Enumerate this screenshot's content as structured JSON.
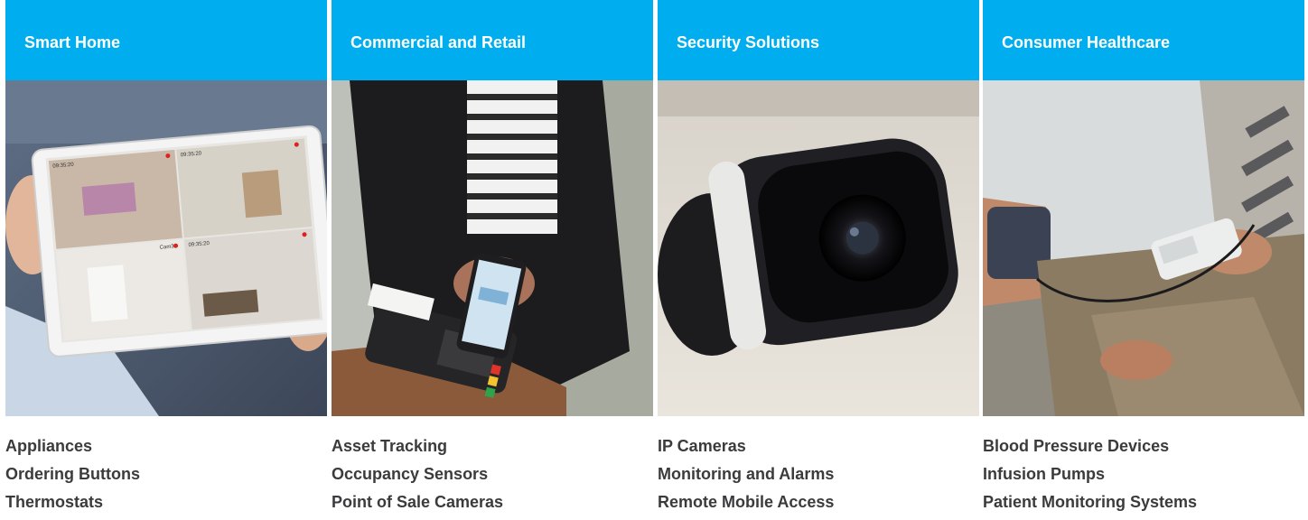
{
  "categories": [
    {
      "title": "Smart Home",
      "image_icon": "tablet-camera-feed-photo",
      "links": [
        "Appliances",
        "Ordering Buttons",
        "Thermostats"
      ],
      "screen_timestamps": [
        "09:35:20",
        "09:35:20",
        "09:35:20"
      ],
      "screen_cam_label": "Cam3"
    },
    {
      "title": "Commercial and Retail",
      "image_icon": "mobile-payment-photo",
      "links": [
        "Asset Tracking",
        "Occupancy Sensors",
        "Point of Sale Cameras"
      ]
    },
    {
      "title": "Security Solutions",
      "image_icon": "security-camera-photo",
      "links": [
        "IP Cameras",
        "Monitoring and Alarms",
        "Remote Mobile Access"
      ]
    },
    {
      "title": "Consumer Healthcare",
      "image_icon": "blood-pressure-photo",
      "links": [
        "Blood Pressure Devices",
        "Infusion Pumps",
        "Patient Monitoring Systems"
      ]
    }
  ],
  "colors": {
    "header_bg": "#00aeef",
    "header_text": "#ffffff",
    "link_text": "#3b3b3d"
  }
}
